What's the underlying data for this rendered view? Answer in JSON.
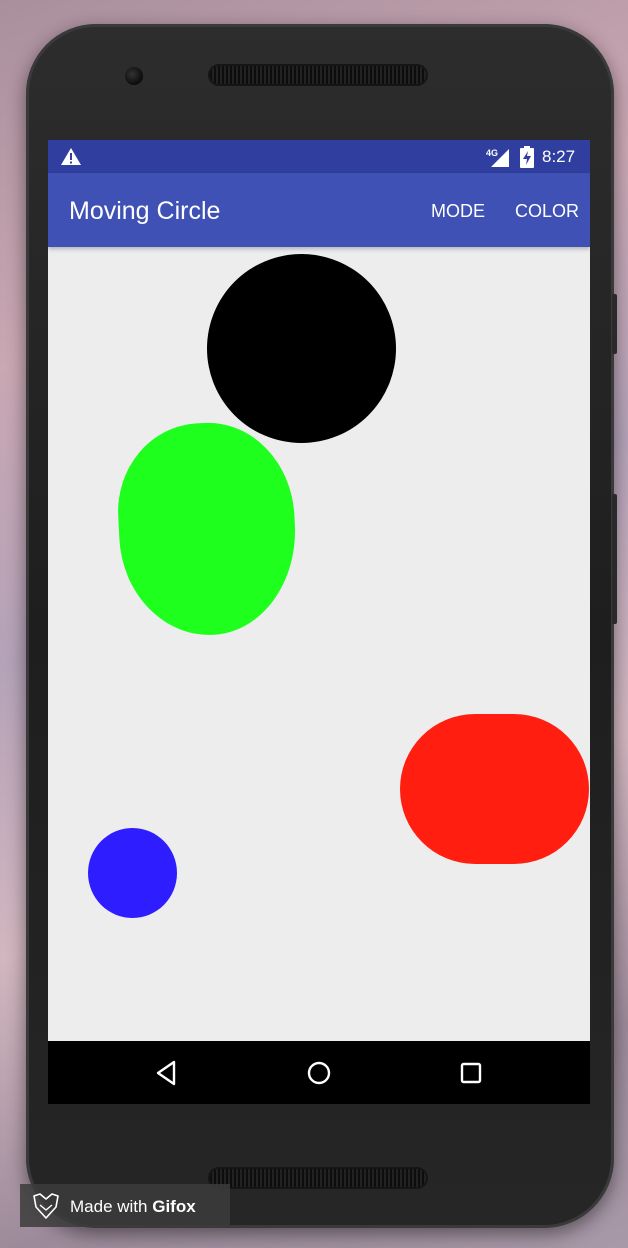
{
  "status_bar": {
    "time": "8:27",
    "network_label": "4G",
    "icons": [
      "warning-icon",
      "signal-icon",
      "battery-charging-icon"
    ]
  },
  "app_bar": {
    "title": "Moving Circle",
    "actions": [
      {
        "label": "MODE"
      },
      {
        "label": "COLOR"
      }
    ]
  },
  "canvas": {
    "background": "#ededed",
    "shapes": [
      {
        "name": "black-circle",
        "color": "#000000"
      },
      {
        "name": "green-blob",
        "color": "#1eff1e"
      },
      {
        "name": "red-capsule",
        "color": "#ff1e10"
      },
      {
        "name": "blue-circle",
        "color": "#2e1eff"
      }
    ]
  },
  "nav_bar": {
    "icons": [
      "back-icon",
      "home-icon",
      "recents-icon"
    ]
  },
  "watermark": {
    "prefix": "Made with",
    "brand": "Gifox",
    "icon": "gifox-fox-icon"
  },
  "colors": {
    "status_bar": "#303f9f",
    "app_bar": "#3f51b5"
  }
}
